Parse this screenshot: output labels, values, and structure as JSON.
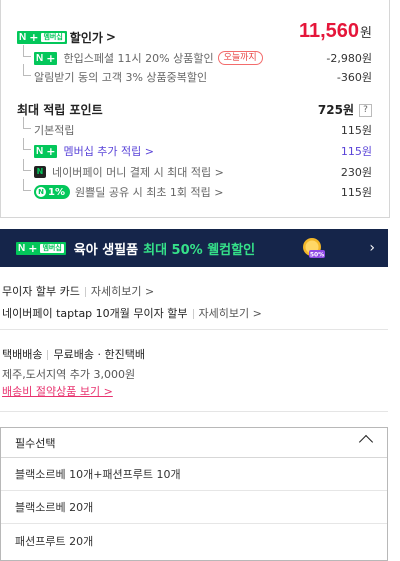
{
  "discount": {
    "badge": {
      "n": "N",
      "plus": "+",
      "membership": "멤버십"
    },
    "label": "할인가",
    "chevron": ">",
    "price": "11,560",
    "price_unit": "원",
    "items": [
      {
        "label": "한입스페셜 11시 20% 상품할인",
        "tag": "오늘까지",
        "value": "-2,980원"
      },
      {
        "label": "알림받기 동의 고객 3% 상품중복할인",
        "value": "-360원"
      }
    ]
  },
  "points": {
    "title": "최대 적립 포인트",
    "total": "725원",
    "help": "?",
    "items": [
      {
        "label": "기본적립",
        "value": "115원"
      },
      {
        "label": "멤버십 추가 적립 >",
        "value": "115원"
      },
      {
        "label": "네이버페이 머니 결제 시 최대 적립 >",
        "value": "230원",
        "icon": "N"
      },
      {
        "label": "원쁠딜 공유 시 최초 1회 적립 >",
        "value": "115원",
        "pill": "1%"
      }
    ]
  },
  "banner": {
    "text": "육아 생필품",
    "highlight": "최대 50% 웰컴할인",
    "coin": "50%",
    "chevron": "›"
  },
  "cards": [
    {
      "label": "무이자 할부 카드",
      "link": "자세히보기 >"
    },
    {
      "label": "네이버페이 taptap 10개월 무이자 할부",
      "link": "자세히보기 >"
    }
  ],
  "delivery": {
    "type": "택배배송",
    "fee": "무료배송 · 한진택배",
    "extra": "제주,도서지역 추가 3,000원",
    "saving_link": "배송비 절약상품 보기 >"
  },
  "select": {
    "title": "필수선택",
    "options": [
      "블랙소르베 10개+패션프루트 10개",
      "블랙소르베 20개",
      "패션프루트 20개"
    ]
  },
  "colors": {
    "price": "#e5163a",
    "naver_green": "#03c75a",
    "banner_bg": "#15254a",
    "link_purple": "#5a44d8",
    "link_pink": "#e8336f"
  }
}
